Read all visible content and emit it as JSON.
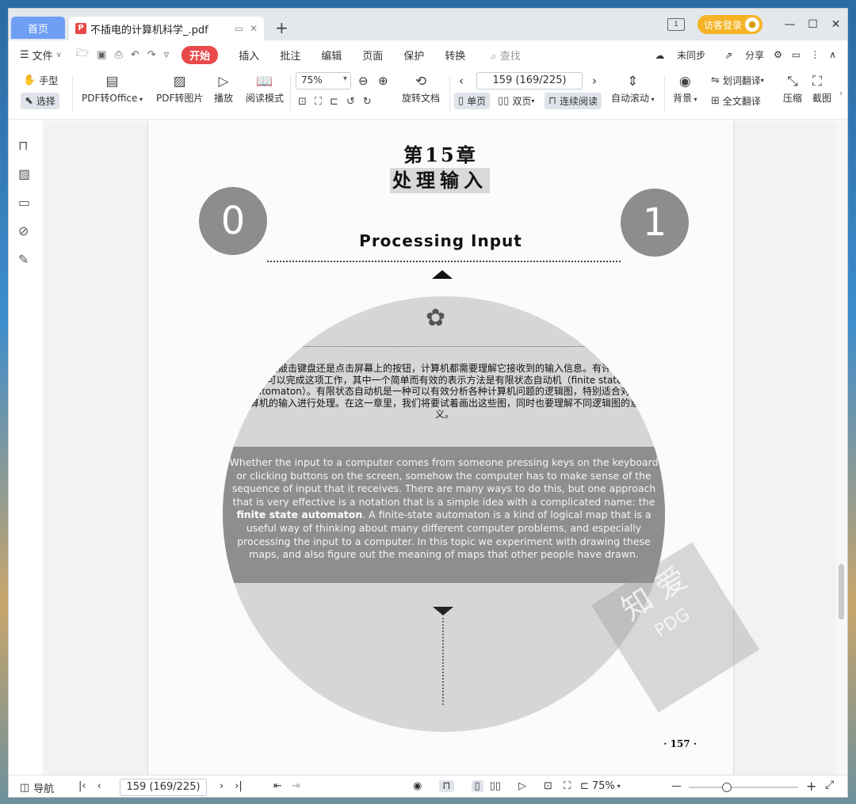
{
  "tabs": {
    "home_label": "首页",
    "doc_title": "不插电的计算机科学_.pdf",
    "add_label": "+"
  },
  "titlebar": {
    "page_indicator_icon": "1",
    "login_label": "访客登录"
  },
  "menu": {
    "file_label": "文件",
    "tabs": [
      "开始",
      "插入",
      "批注",
      "编辑",
      "页面",
      "保护",
      "转换"
    ],
    "search_placeholder": "查找",
    "sync_label": "未同步",
    "share_label": "分享"
  },
  "ribbon": {
    "hand_label": "手型",
    "select_label": "选择",
    "pdf_to_office": "PDF转Office",
    "pdf_to_image": "PDF转图片",
    "play_label": "播放",
    "read_mode": "阅读模式",
    "zoom_value": "75%",
    "rotate_doc": "旋转文档",
    "page_value": "159 (169/225)",
    "single_page": "单页",
    "double_page": "双页",
    "continuous_read": "连续阅读",
    "auto_scroll": "自动滚动",
    "background": "背景",
    "word_translate": "划词翻译",
    "full_translate": "全文翻译",
    "compress": "压缩",
    "screenshot": "截图"
  },
  "page": {
    "chapter": "第15章",
    "title_cn": "处理输入",
    "left_digit": "0",
    "right_digit": "1",
    "title_en": "Processing Input",
    "cn_paragraph": "无论是敲击键盘还是点击屏幕上的按钮，计算机都需要理解它接收到的输入信息。有许多方式可以完成这项工作，其中一个简单而有效的表示方法是有限状态自动机（finite state automaton）。有限状态自动机是一种可以有效分析各种计算机问题的逻辑图，特别适合对计算机的输入进行处理。在这一章里，我们将要试着画出这些图，同时也要理解不同逻辑图的意义。",
    "en_paragraph_before": "Whether the input to a computer comes from someone pressing keys on the keyboard or clicking buttons on the screen, somehow the computer has to make sense of the sequence of input that it receives. There are many ways to do this, but one approach that is very effective is a notation that is a simple idea with a complicated name: the ",
    "en_paragraph_bold": "finite state automaton",
    "en_paragraph_after": ". A finite-state automaton is a kind of logical map that is a useful way of thinking about many different computer problems, and especially processing the input to a computer. In this topic we experiment with drawing these maps, and also figure out the meaning of maps that other people have drawn.",
    "page_number": "· 157 ·",
    "stamp_text": "知 爱",
    "stamp_sub": "PDG"
  },
  "statusbar": {
    "nav_label": "导航",
    "page_value": "159 (169/225)",
    "zoom_value": "75%",
    "zoom_level_fraction": 0.35
  }
}
